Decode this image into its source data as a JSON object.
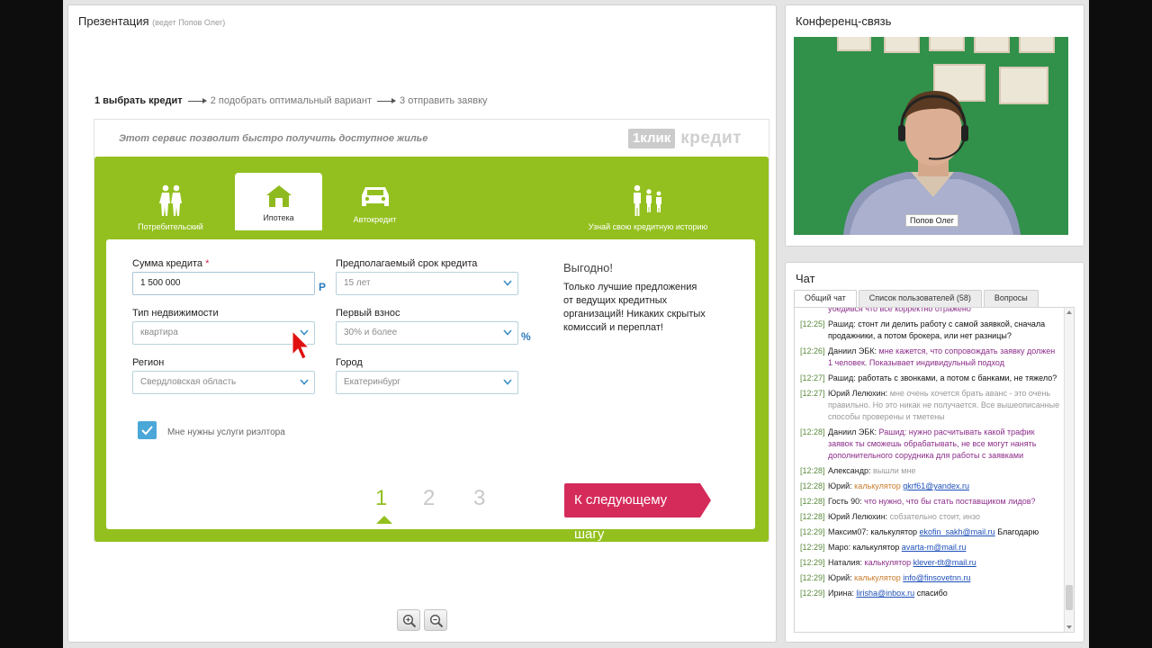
{
  "presentation": {
    "title": "Презентация",
    "presenter": "(ведет Попов Олег)",
    "steps": [
      "1 выбрать кредит",
      "2 подобрать оптимальный вариант",
      "3 отправить заявку"
    ],
    "slide": {
      "tagline": "Этот сервис позволит быстро получить доступное жилье",
      "logo_box": "1клик",
      "logo_word": "кредит",
      "tabs": [
        "Потребительский",
        "Ипотека",
        "Автокредит",
        "Узнай свою кредитную историю"
      ],
      "selected_tab": "Ипотека",
      "form": {
        "amount_label": "Сумма кредита",
        "amount_required": "*",
        "amount_value": "1 500 000",
        "amount_unit": "Р",
        "term_label": "Предполагаемый срок кредита",
        "term_value": "15 лет",
        "property_label": "Тип недвижимости",
        "property_value": "квартира",
        "downpayment_label": "Первый взнос",
        "downpayment_value": "30% и более",
        "downpayment_unit": "%",
        "region_label": "Регион",
        "region_value": "Свердловская область",
        "city_label": "Город",
        "city_value": "Екатеринбург",
        "realtor_label": "Мне нужны услуги риэлтора",
        "realtor_checked": true
      },
      "promo_title": "Выгодно!",
      "promo_text": "Только лучшие предложения от ведущих кредитных организаций! Никаких скрытых комиссий и переплат!",
      "pages": [
        "1",
        "2",
        "3"
      ],
      "current_page": "1",
      "next_button": "К следующему шагу"
    }
  },
  "conference": {
    "title": "Конференц-связь",
    "participant": "Попов Олег"
  },
  "chat": {
    "title": "Чат",
    "tabs": [
      "Общий чат",
      "Список пользователей (58)",
      "Вопросы"
    ],
    "messages": [
      {
        "time": "",
        "nick": "",
        "text": "убедився что все корректно отражено",
        "style": "purple"
      },
      {
        "time": "[12:25]",
        "nick": "Рашид:",
        "text": "стонт ли делить работу с самой заявкой, сначала продажники, а потом брокера, или нет разницы?",
        "style": "normal"
      },
      {
        "time": "[12:26]",
        "nick": "Даниил ЭБК:",
        "text": "мне кажется, что сопровождать заявку должен 1 человек. Показывает индивидульный подход",
        "style": "purple"
      },
      {
        "time": "[12:27]",
        "nick": "Рашид:",
        "text": "работать с звонками, а потом с банками, не тяжело?",
        "style": "normal"
      },
      {
        "time": "[12:27]",
        "nick": "Юрий Лелюхин:",
        "text": "мне очень хочется брать аванс - это очень правильно. Но это никак не получается. Все вышеописанные способы проверены и тметены",
        "style": "grey"
      },
      {
        "time": "[12:28]",
        "nick": "Даниил ЭБК:",
        "text": "Рашид:  нужно расчитывать какой трафик заявок ты сможешь обрабатывать, не все могут нанять дополнительного сорудника для работы с заявками",
        "style": "purple"
      },
      {
        "time": "[12:28]",
        "nick": "Александр:",
        "text": "вышли мне",
        "style": "grey"
      },
      {
        "time": "[12:28]",
        "nick": "Юрий:",
        "text": "калькулятор",
        "link": "gkrf61@yandex.ru",
        "style": "orange"
      },
      {
        "time": "[12:28]",
        "nick": "Гость 90:",
        "text": "что нужно, что бы стать поставщиком лидов?",
        "style": "purple"
      },
      {
        "time": "[12:28]",
        "nick": "Юрий Лелюхин:",
        "text": "собзательно стоит, инзо",
        "style": "grey"
      },
      {
        "time": "[12:29]",
        "nick": "Максим07:",
        "text": "калькулятор",
        "link": "ekofin_sakh@mail.ru",
        "after": "Благодарю",
        "style": "normal"
      },
      {
        "time": "[12:29]",
        "nick": "Маро:",
        "text": "калькулятор",
        "link": "avarta-m@mail.ru",
        "style": "normal"
      },
      {
        "time": "[12:29]",
        "nick": "Наталия:",
        "text": "калькулятор",
        "link": "klever-tlt@mail.ru",
        "style": "purple"
      },
      {
        "time": "[12:29]",
        "nick": "Юрий:",
        "text": "калькулятор",
        "link": "info@finsovetnn.ru",
        "style": "orange"
      },
      {
        "time": "[12:29]",
        "nick": "Ирина:",
        "text": "",
        "link": "lirisha@inbox.ru",
        "after": "спасибо",
        "style": "normal"
      }
    ]
  }
}
